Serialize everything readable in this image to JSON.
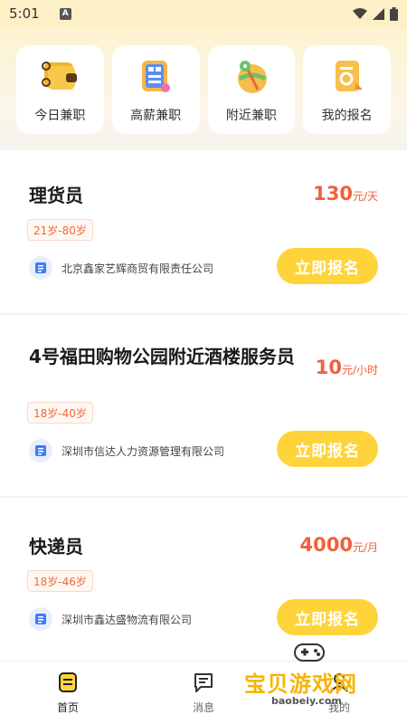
{
  "status_bar": {
    "time": "5:01",
    "notification_glyph": "A"
  },
  "quick_links": [
    {
      "label": "今日兼职",
      "icon": "wallet-icon"
    },
    {
      "label": "高薪兼职",
      "icon": "calculator-icon"
    },
    {
      "label": "附近兼职",
      "icon": "map-icon"
    },
    {
      "label": "我的报名",
      "icon": "document-icon"
    }
  ],
  "jobs": [
    {
      "title": "理货员",
      "salary": "130",
      "unit": "元/天",
      "age": "21岁-80岁",
      "company": "北京鑫家艺辉商贸有限责任公司",
      "apply_label": "立即报名"
    },
    {
      "title": "4号福田购物公园附近酒楼服务员",
      "salary": "10",
      "unit": "元/小时",
      "age": "18岁-40岁",
      "company": "深圳市信达人力资源管理有限公司",
      "apply_label": "立即报名"
    },
    {
      "title": "快递员",
      "salary": "4000",
      "unit": "元/月",
      "age": "18岁-46岁",
      "company": "深圳市鑫达盛物流有限公司",
      "apply_label": "立即报名"
    }
  ],
  "tabbar": [
    {
      "label": "首页",
      "icon": "home-list-icon",
      "active": true
    },
    {
      "label": "消息",
      "icon": "message-icon",
      "active": false
    },
    {
      "label": "我的",
      "icon": "profile-icon",
      "active": false
    }
  ],
  "watermark": {
    "text": "宝贝游戏网",
    "url": "baobeiy.com"
  },
  "colors": {
    "accent_yellow": "#ffd43b",
    "salary_red": "#f0603c",
    "header_bg": "#fdf0c6"
  }
}
